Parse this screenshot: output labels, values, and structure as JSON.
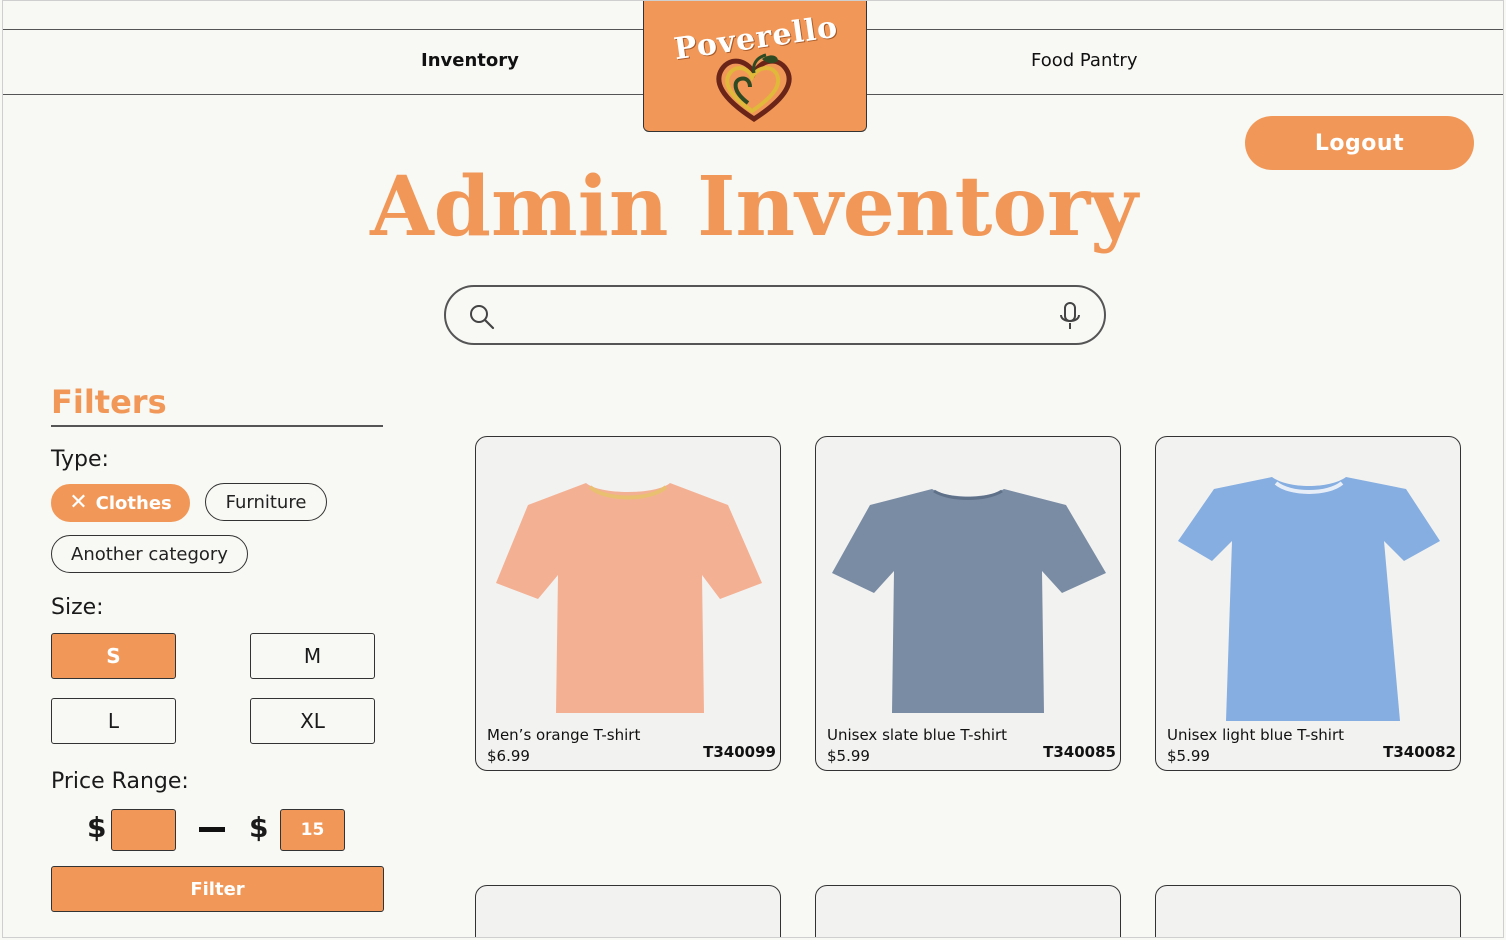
{
  "nav": {
    "left_link": "Inventory",
    "right_link": "Food Pantry",
    "logo_text": "Poverello"
  },
  "header": {
    "logout_label": "Logout",
    "title": "Admin Inventory"
  },
  "search": {
    "value": "",
    "placeholder": ""
  },
  "filters": {
    "title": "Filters",
    "type_label": "Type:",
    "types": [
      {
        "label": "Clothes",
        "active": true
      },
      {
        "label": "Furniture",
        "active": false
      },
      {
        "label": "Another category",
        "active": false
      }
    ],
    "size_label": "Size:",
    "sizes": [
      {
        "label": "S",
        "active": true
      },
      {
        "label": "M",
        "active": false
      },
      {
        "label": "L",
        "active": false
      },
      {
        "label": "XL",
        "active": false
      }
    ],
    "price_label": "Price Range:",
    "currency": "$",
    "price_min": "",
    "price_max": "15",
    "filter_button": "Filter"
  },
  "products": [
    {
      "name": "Men’s orange T-shirt",
      "price": "$6.99",
      "sku": "T340099",
      "color": "#f4b093"
    },
    {
      "name": "Unisex slate blue T-shirt",
      "price": "$5.99",
      "sku": "T340085",
      "color": "#7a8ca4"
    },
    {
      "name": "Unisex light blue T-shirt",
      "price": "$5.99",
      "sku": "T340082",
      "color": "#86aee0"
    }
  ],
  "colors": {
    "accent": "#f19858",
    "background": "#f8f8f4"
  }
}
